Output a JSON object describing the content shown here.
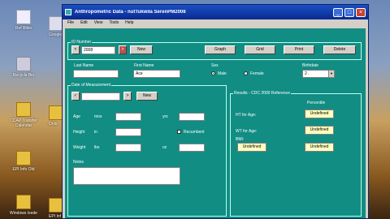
{
  "desktop": {
    "icons": [
      {
        "label": "Ref Bible"
      },
      {
        "label": "Recycle Bin"
      },
      {
        "label": "CCAP Transfer Calendar"
      },
      {
        "label": "EPI Info Old"
      },
      {
        "label": "Windows Ixede"
      }
    ],
    "partial_icons": [
      {
        "label": "Google"
      },
      {
        "label": "Onlo"
      },
      {
        "label": "EPI Inf"
      }
    ]
  },
  "window": {
    "title": "Anthropometric Data - nutTukwila SerenPM2008",
    "menu": [
      "File",
      "Edit",
      "View",
      "Tools",
      "Help"
    ]
  },
  "id_group": {
    "legend": "ID Number",
    "id_value": "2008",
    "prev_label": "<",
    "next_label": ">",
    "new_label": "New",
    "buttons": {
      "graph": "Graph",
      "grid": "Grid",
      "print": "Print",
      "delete": "Delete"
    }
  },
  "person": {
    "last_name_label": "Last Name",
    "first_name_label": "First Name",
    "first_name_value": "Ace",
    "sex_label": "Sex",
    "male_label": "Male",
    "female_label": "Female",
    "birthdate_label": "Birthdate",
    "birthdate_value": "2 ."
  },
  "measurement": {
    "legend": "Date of Measurement",
    "new_label": "New",
    "age_label": "Age",
    "age_unit": "mos",
    "yrs_label": "yrs",
    "height_label": "Height",
    "height_unit": "in",
    "recumbent_label": "Recumbent",
    "weight_label": "Weight",
    "weight_unit": "lbs",
    "oz_label": "oz",
    "notes_label": "Notes"
  },
  "results": {
    "legend": "Results - CDC 2000 Reference",
    "percentile_label": "Percentile",
    "ht_age_label": "HT for Age:",
    "wt_age_label": "WT for Age:",
    "bmi_label": "BMI:",
    "undefined_label": "Undefined"
  }
}
